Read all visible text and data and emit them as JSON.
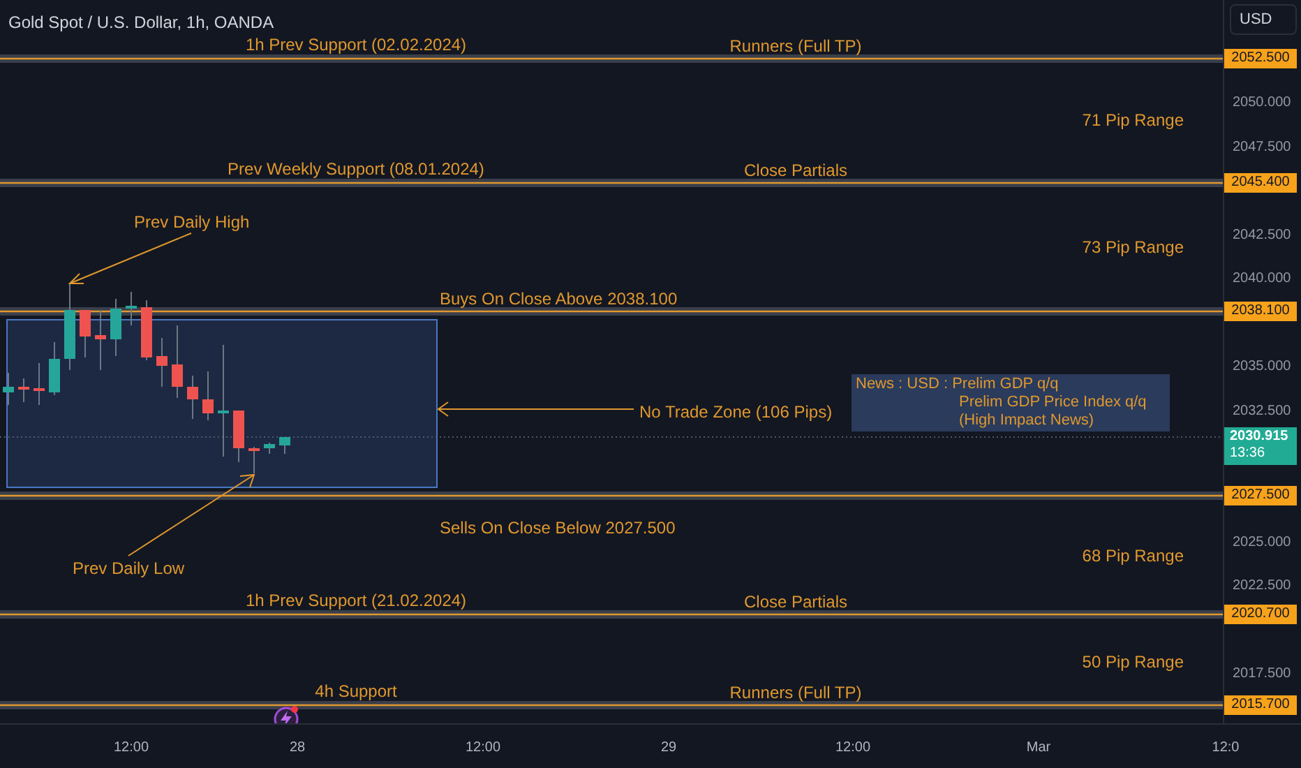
{
  "chart": {
    "title": "Gold Spot / U.S. Dollar, 1h, OANDA"
  },
  "currency_button": "USD",
  "levels": [
    {
      "price": "2052.500",
      "left_note": "1h Prev Support (02.02.2024)",
      "right_note": "Runners (Full TP)"
    },
    {
      "price": "2045.400",
      "left_note": "Prev Weekly Support (08.01.2024)",
      "right_note": "Close Partials"
    },
    {
      "price": "2038.100"
    },
    {
      "price": "2027.500"
    },
    {
      "price": "2020.700",
      "left_note": "1h Prev Support (21.02.2024)",
      "right_note": "Close Partials"
    },
    {
      "price": "2015.700",
      "left_note": "4h Support",
      "right_note": "Runners (Full TP)"
    }
  ],
  "range_notes": [
    "71 Pip Range",
    "73 Pip Range",
    "68 Pip Range",
    "50 Pip Range"
  ],
  "zone": {
    "label": "No Trade Zone (106 Pips)",
    "buy_note": "Buys On Close Above 2038.100",
    "sell_note": "Sells On Close Below 2027.500"
  },
  "callouts": [
    "Prev Daily High",
    "Prev Daily Low"
  ],
  "news": {
    "lines": [
      "News : USD : Prelim GDP q/q",
      "Prelim GDP Price Index q/q",
      "(High Impact News)"
    ]
  },
  "price_axis": {
    "ticks": [
      "2050.000",
      "2047.500",
      "2042.500",
      "2040.000",
      "2035.000",
      "2032.500",
      "2025.000",
      "2022.500",
      "2017.500"
    ],
    "current": {
      "price": "2030.915",
      "countdown": "13:36"
    }
  },
  "time_axis": [
    "12:00",
    "28",
    "12:00",
    "29",
    "12:00",
    "Mar",
    "12:0"
  ]
}
